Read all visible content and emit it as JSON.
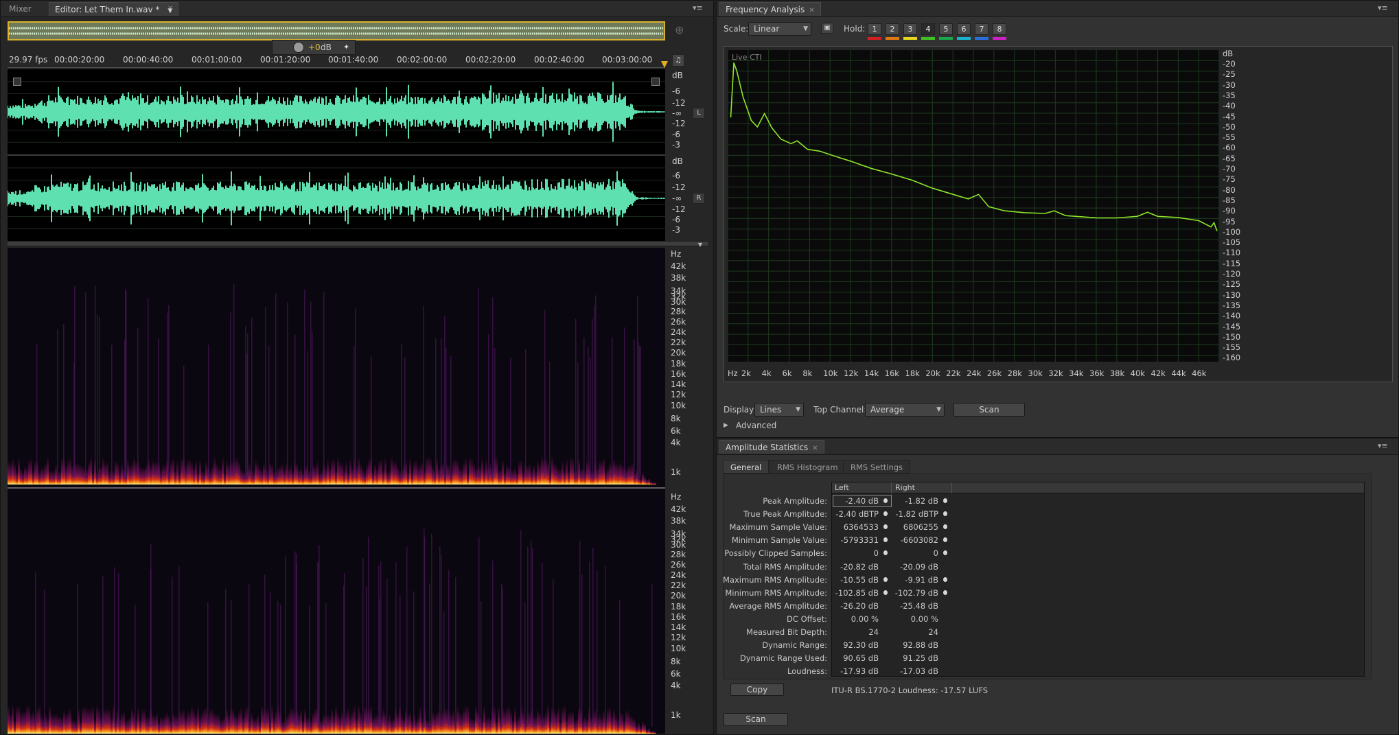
{
  "editor": {
    "tabs": [
      {
        "label": "Mixer"
      },
      {
        "label": "Editor: Let Them In.wav *"
      }
    ],
    "fps": "29.97 fps",
    "timeline": [
      "00:00:20:00",
      "00:00:40:00",
      "00:01:00:00",
      "00:01:20:00",
      "00:01:40:00",
      "00:02:00:00",
      "00:02:20:00",
      "00:02:40:00",
      "00:03:00:00"
    ],
    "gain": "+0",
    "gain_unit": "dB",
    "channel_left": "L",
    "channel_right": "R",
    "db_unit": "dB",
    "db_scale_top": [
      "-6",
      "-12",
      "-∞",
      "-12",
      "-6",
      "-3"
    ],
    "db_scale_bottom": [
      "-6",
      "-12",
      "-∞",
      "-12",
      "-6",
      "-3"
    ],
    "hz_unit": "Hz",
    "hz_scale": [
      "42k",
      "38k",
      "34k",
      "32k",
      "30k",
      "28k",
      "26k",
      "24k",
      "22k",
      "20k",
      "18k",
      "16k",
      "14k",
      "12k",
      "10k",
      "8k",
      "6k",
      "4k",
      "1k"
    ]
  },
  "frequency": {
    "tab": "Frequency Analysis",
    "scale_label": "Scale:",
    "scale_value": "Linear",
    "hold_label": "Hold:",
    "holds": [
      {
        "label": "1",
        "color": "#d42020"
      },
      {
        "label": "2",
        "color": "#e07a10"
      },
      {
        "label": "3",
        "color": "#e6d81a"
      },
      {
        "label": "4",
        "color": "#3ec422"
      },
      {
        "label": "5",
        "color": "#1aa84a"
      },
      {
        "label": "6",
        "color": "#1ab4d0"
      },
      {
        "label": "7",
        "color": "#2a6fe0"
      },
      {
        "label": "8",
        "color": "#d020c8"
      }
    ],
    "graph_label": "Live CTI",
    "x_ticks": [
      "Hz",
      "2k",
      "4k",
      "6k",
      "8k",
      "10k",
      "12k",
      "14k",
      "16k",
      "18k",
      "20k",
      "22k",
      "24k",
      "26k",
      "28k",
      "30k",
      "32k",
      "34k",
      "36k",
      "38k",
      "40k",
      "42k",
      "44k",
      "46k"
    ],
    "y_unit": "dB",
    "y_ticks": [
      "-20",
      "-25",
      "-30",
      "-35",
      "-40",
      "-45",
      "-50",
      "-55",
      "-60",
      "-65",
      "-70",
      "-75",
      "-80",
      "-85",
      "-90",
      "-95",
      "-100",
      "-105",
      "-110",
      "-115",
      "-120",
      "-125",
      "-130",
      "-135",
      "-140",
      "-145",
      "-150",
      "-155",
      "-160"
    ],
    "line_color": "#8ee62a",
    "display_label": "Display:",
    "display_value": "Lines",
    "top_channel_label": "Top Channel:",
    "top_channel_value": "Average",
    "scan_label": "Scan",
    "advanced_label": "Advanced"
  },
  "amplitude": {
    "tab": "Amplitude Statistics",
    "subtabs": [
      "General",
      "RMS Histogram",
      "RMS Settings"
    ],
    "col_left": "Left",
    "col_right": "Right",
    "rows": [
      {
        "label": "Peak Amplitude:",
        "left": "-2.40 dB",
        "right": "-1.82 dB"
      },
      {
        "label": "True Peak Amplitude:",
        "left": "-2.40 dBTP",
        "right": "-1.82 dBTP"
      },
      {
        "label": "Maximum Sample Value:",
        "left": "6364533",
        "right": "6806255"
      },
      {
        "label": "Minimum Sample Value:",
        "left": "-5793331",
        "right": "-6603082"
      },
      {
        "label": "Possibly Clipped Samples:",
        "left": "0",
        "right": "0"
      },
      {
        "label": "Total RMS Amplitude:",
        "left": "-20.82 dB",
        "right": "-20.09 dB"
      },
      {
        "label": "Maximum RMS Amplitude:",
        "left": "-10.55 dB",
        "right": "-9.91 dB"
      },
      {
        "label": "Minimum RMS Amplitude:",
        "left": "-102.85 dB",
        "right": "-102.79 dB"
      },
      {
        "label": "Average RMS Amplitude:",
        "left": "-26.20 dB",
        "right": "-25.48 dB"
      },
      {
        "label": "DC Offset:",
        "left": "0.00 %",
        "right": "0.00 %"
      },
      {
        "label": "Measured Bit Depth:",
        "left": "24",
        "right": "24"
      },
      {
        "label": "Dynamic Range:",
        "left": "92.30 dB",
        "right": "92.88 dB"
      },
      {
        "label": "Dynamic Range Used:",
        "left": "90.65 dB",
        "right": "91.25 dB"
      },
      {
        "label": "Loudness:",
        "left": "-17.93 dB",
        "right": "-17.03 dB"
      }
    ],
    "copy_label": "Copy",
    "loudness_note": "ITU-R BS.1770-2 Loudness: -17.57 LUFS",
    "scan_label": "Scan"
  },
  "colors": {
    "waveform": "#5fe0b0",
    "accent": "#d8b030"
  }
}
